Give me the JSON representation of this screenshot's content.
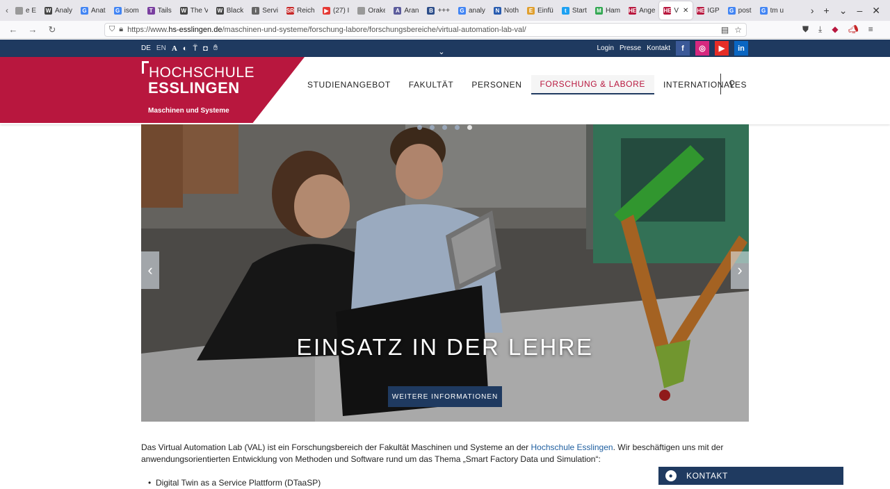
{
  "browser": {
    "tabs": [
      {
        "label": "e E",
        "fav": "",
        "color": "#999"
      },
      {
        "label": "Analy",
        "fav": "W",
        "color": "#444"
      },
      {
        "label": "Anat",
        "fav": "G",
        "color": "#4285f4"
      },
      {
        "label": "isom",
        "fav": "G",
        "color": "#4285f4"
      },
      {
        "label": "Tails",
        "fav": "T",
        "color": "#7a3fa0"
      },
      {
        "label": "The V",
        "fav": "W",
        "color": "#444"
      },
      {
        "label": "Black",
        "fav": "W",
        "color": "#444"
      },
      {
        "label": "Servi",
        "fav": "i",
        "color": "#666"
      },
      {
        "label": "Reich",
        "fav": "SR",
        "color": "#c62828"
      },
      {
        "label": "(27) I",
        "fav": "▶",
        "color": "#e53935"
      },
      {
        "label": "Orakeln",
        "fav": "",
        "color": "#999"
      },
      {
        "label": "Aran",
        "fav": "A",
        "color": "#5c5c9c"
      },
      {
        "label": "+++",
        "fav": "B",
        "color": "#2d4e8a"
      },
      {
        "label": "analy",
        "fav": "G",
        "color": "#4285f4"
      },
      {
        "label": "Noth",
        "fav": "N",
        "color": "#2a5db0"
      },
      {
        "label": "Einfü",
        "fav": "E",
        "color": "#e0a030"
      },
      {
        "label": "Start",
        "fav": "t",
        "color": "#1da1f2"
      },
      {
        "label": "Ham",
        "fav": "M",
        "color": "#34a853"
      },
      {
        "label": "Ange",
        "fav": "HE",
        "color": "#b8173e"
      }
    ],
    "active_tab": {
      "label": "Vir",
      "fav": "HE",
      "close": "✕"
    },
    "tabs_after": [
      {
        "label": "IGP",
        "fav": "HE",
        "color": "#b8173e"
      },
      {
        "label": "post",
        "fav": "G",
        "color": "#4285f4"
      },
      {
        "label": "tm u",
        "fav": "G",
        "color": "#4285f4"
      }
    ],
    "url_prefix": "https://www.",
    "url_host": "hs-esslingen.de",
    "url_path": "/maschinen-und-systeme/forschung-labore/forschungsbereiche/virtual-automation-lab-val/"
  },
  "topbar": {
    "lang_de": "DE",
    "lang_en": "EN",
    "links": [
      "Login",
      "Presse",
      "Kontakt"
    ],
    "social": [
      {
        "name": "facebook",
        "glyph": "f",
        "color": "#3b5998"
      },
      {
        "name": "instagram",
        "glyph": "◎",
        "color": "#d6287f"
      },
      {
        "name": "youtube",
        "glyph": "▶",
        "color": "#e52d27"
      },
      {
        "name": "linkedin",
        "glyph": "in",
        "color": "#0a66c2"
      }
    ]
  },
  "logo": {
    "line1": "HOCHSCHULE",
    "line2": "ESSLINGEN",
    "sub": "Maschinen und Systeme"
  },
  "nav": {
    "items": [
      "STUDIENANGEBOT",
      "FAKULTÄT",
      "PERSONEN",
      "FORSCHUNG & LABORE",
      "INTERNATIONALES"
    ],
    "active_index": 3
  },
  "hero": {
    "title": "EINSATZ IN DER LEHRE",
    "button": "WEITERE INFORMATIONEN",
    "slide_count": 5,
    "active_slide": 4
  },
  "content": {
    "intro_before_link": "Das Virtual Automation Lab (VAL) ist ein Forschungsbereich der Fakultät Maschinen und Systeme an der ",
    "link": "Hochschule Esslingen",
    "intro_after_link": ". Wir beschäftigen uns mit der anwendungsorientierten Entwicklung von Methoden und Software rund um das Thema „Smart Factory Data und Simulation“:",
    "bullets": [
      "Digital Twin as a Service Plattform (DTaaSP)"
    ]
  },
  "contact": {
    "label": "KONTAKT"
  },
  "colors": {
    "brand_red": "#b8173e",
    "brand_navy": "#1f3a60"
  }
}
